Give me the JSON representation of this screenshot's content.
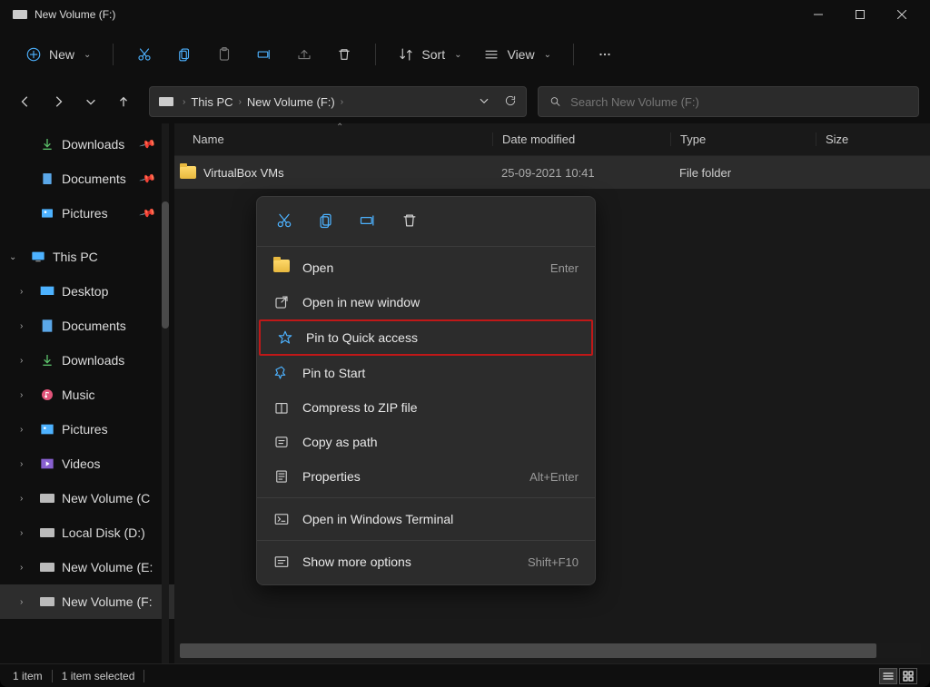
{
  "title": "New Volume (F:)",
  "toolbar": {
    "new": "New",
    "sort": "Sort",
    "view": "View"
  },
  "breadcrumb": {
    "pc": "This PC",
    "vol": "New Volume (F:)"
  },
  "search": {
    "placeholder": "Search New Volume (F:)"
  },
  "sidebar": {
    "quick": [
      {
        "label": "Downloads"
      },
      {
        "label": "Documents"
      },
      {
        "label": "Pictures"
      }
    ],
    "pc_label": "This PC",
    "pc": [
      {
        "label": "Desktop"
      },
      {
        "label": "Documents"
      },
      {
        "label": "Downloads"
      },
      {
        "label": "Music"
      },
      {
        "label": "Pictures"
      },
      {
        "label": "Videos"
      },
      {
        "label": "New Volume (C"
      },
      {
        "label": "Local Disk (D:)"
      },
      {
        "label": "New Volume (E:"
      },
      {
        "label": "New Volume (F:"
      }
    ]
  },
  "columns": {
    "name": "Name",
    "date": "Date modified",
    "type": "Type",
    "size": "Size"
  },
  "rows": [
    {
      "name": "VirtualBox VMs",
      "date": "25-09-2021 10:41",
      "type": "File folder",
      "size": ""
    }
  ],
  "context": {
    "open": "Open",
    "open_sc": "Enter",
    "open_new": "Open in new window",
    "pin_quick": "Pin to Quick access",
    "pin_start": "Pin to Start",
    "zip": "Compress to ZIP file",
    "copy_path": "Copy as path",
    "props": "Properties",
    "props_sc": "Alt+Enter",
    "terminal": "Open in Windows Terminal",
    "more": "Show more options",
    "more_sc": "Shift+F10"
  },
  "status": {
    "items": "1 item",
    "selected": "1 item selected"
  }
}
